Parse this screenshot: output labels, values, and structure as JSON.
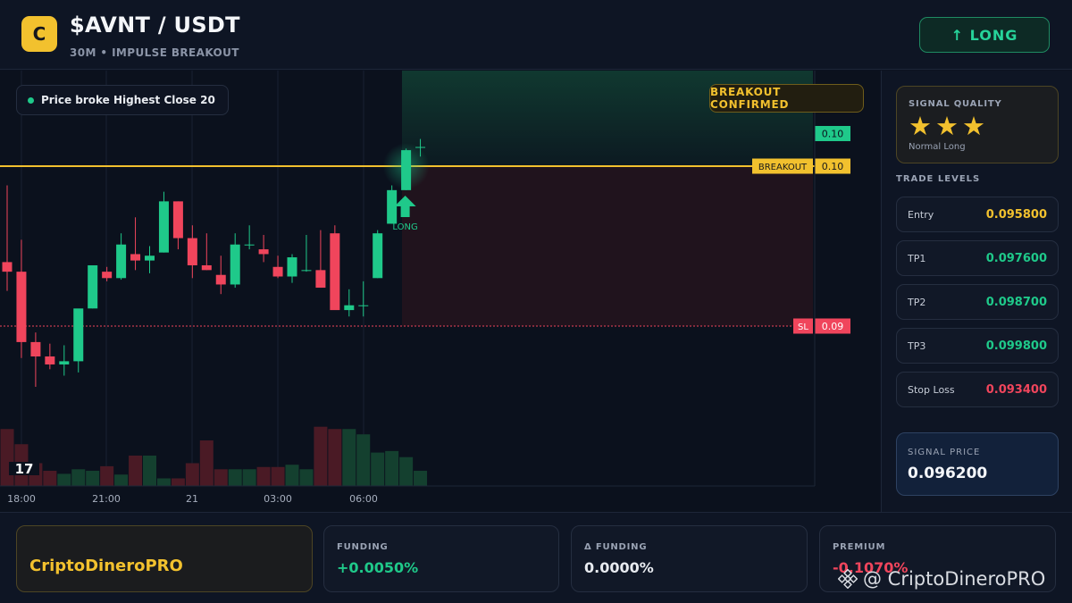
{
  "header": {
    "logo_letter": "C",
    "title": "$AVNT / USDT",
    "subtitle": "30M • IMPULSE BREAKOUT",
    "direction_button": "↑ LONG"
  },
  "chart": {
    "chip_text": "Price broke Highest Close 20",
    "confirm_badge": "BREAKOUT CONFIRMED",
    "price_tag_top": "0.10",
    "breakout_label": "BREAKOUT",
    "breakout_price": "0.10",
    "sl_label": "SL",
    "sl_price": "0.09",
    "long_marker_label": "LONG",
    "x_ticks": [
      "18:00",
      "21:00",
      "21",
      "03:00",
      "06:00"
    ],
    "tv_logo": "17",
    "colors": {
      "up": "#1fc98a",
      "down": "#f0455c",
      "breakout": "#f2c12e",
      "sl": "#f0455c"
    }
  },
  "chart_data": {
    "type": "candlestick",
    "x_ticks": [
      "18:00",
      "21:00",
      "21",
      "03:00",
      "06:00"
    ],
    "breakout_level": 0.1,
    "stop_loss_level": 0.09,
    "candles": [
      {
        "o": 0.094,
        "h": 0.0988,
        "l": 0.0922,
        "c": 0.0934
      },
      {
        "o": 0.0934,
        "h": 0.0954,
        "l": 0.088,
        "c": 0.089
      },
      {
        "o": 0.089,
        "h": 0.0896,
        "l": 0.0862,
        "c": 0.0881
      },
      {
        "o": 0.0881,
        "h": 0.0889,
        "l": 0.0873,
        "c": 0.0876
      },
      {
        "o": 0.0876,
        "h": 0.0888,
        "l": 0.0869,
        "c": 0.0878
      },
      {
        "o": 0.0878,
        "h": 0.0902,
        "l": 0.0871,
        "c": 0.0911
      },
      {
        "o": 0.0911,
        "h": 0.0935,
        "l": 0.0911,
        "c": 0.0938
      },
      {
        "o": 0.0934,
        "h": 0.0937,
        "l": 0.0928,
        "c": 0.093
      },
      {
        "o": 0.093,
        "h": 0.0958,
        "l": 0.0929,
        "c": 0.0951
      },
      {
        "o": 0.0945,
        "h": 0.0968,
        "l": 0.0935,
        "c": 0.0941
      },
      {
        "o": 0.0941,
        "h": 0.095,
        "l": 0.0933,
        "c": 0.0944
      },
      {
        "o": 0.0946,
        "h": 0.0984,
        "l": 0.0946,
        "c": 0.0978
      },
      {
        "o": 0.0978,
        "h": 0.0978,
        "l": 0.0948,
        "c": 0.0955
      },
      {
        "o": 0.0955,
        "h": 0.0963,
        "l": 0.093,
        "c": 0.0938
      },
      {
        "o": 0.0938,
        "h": 0.0958,
        "l": 0.0935,
        "c": 0.0935
      },
      {
        "o": 0.0932,
        "h": 0.0944,
        "l": 0.092,
        "c": 0.0926
      },
      {
        "o": 0.0926,
        "h": 0.0958,
        "l": 0.0924,
        "c": 0.0951
      },
      {
        "o": 0.0951,
        "h": 0.0963,
        "l": 0.0948,
        "c": 0.0951
      },
      {
        "o": 0.0948,
        "h": 0.0957,
        "l": 0.094,
        "c": 0.0945
      },
      {
        "o": 0.0937,
        "h": 0.0944,
        "l": 0.093,
        "c": 0.0931
      },
      {
        "o": 0.0931,
        "h": 0.0945,
        "l": 0.0927,
        "c": 0.0943
      },
      {
        "o": 0.0935,
        "h": 0.0957,
        "l": 0.0934,
        "c": 0.0935
      },
      {
        "o": 0.0935,
        "h": 0.096,
        "l": 0.0924,
        "c": 0.0924
      },
      {
        "o": 0.0958,
        "h": 0.0963,
        "l": 0.093,
        "c": 0.091
      },
      {
        "o": 0.091,
        "h": 0.0923,
        "l": 0.0906,
        "c": 0.0913
      },
      {
        "o": 0.0913,
        "h": 0.0928,
        "l": 0.0906,
        "c": 0.0913
      },
      {
        "o": 0.093,
        "h": 0.096,
        "l": 0.093,
        "c": 0.0958
      },
      {
        "o": 0.0964,
        "h": 0.0988,
        "l": 0.0964,
        "c": 0.0985
      },
      {
        "o": 0.0985,
        "h": 0.1011,
        "l": 0.0985,
        "c": 0.101
      },
      {
        "o": 0.1012,
        "h": 0.1017,
        "l": 0.1006,
        "c": 0.1012
      }
    ],
    "volumes": [
      0.75,
      0.55,
      0.3,
      0.2,
      0.16,
      0.22,
      0.2,
      0.26,
      0.15,
      0.4,
      0.4,
      0.1,
      0.1,
      0.3,
      0.6,
      0.22,
      0.22,
      0.22,
      0.25,
      0.25,
      0.28,
      0.22,
      0.78,
      0.75,
      0.75,
      0.68,
      0.44,
      0.46,
      0.38,
      0.2
    ]
  },
  "sidebar": {
    "quality_label": "SIGNAL QUALITY",
    "stars": "★★★",
    "quality_sub": "Normal Long",
    "levels_title": "TRADE LEVELS",
    "levels": [
      {
        "name": "Entry",
        "value": "0.095800"
      },
      {
        "name": "TP1",
        "value": "0.097600"
      },
      {
        "name": "TP2",
        "value": "0.098700"
      },
      {
        "name": "TP3",
        "value": "0.099800"
      },
      {
        "name": "Stop Loss",
        "value": "0.093400"
      }
    ],
    "level_colors": [
      "#f2c12e",
      "#1fc98a",
      "#1fc98a",
      "#1fc98a",
      "#f0455c"
    ],
    "signal_price_label": "SIGNAL PRICE",
    "signal_price": "0.096200"
  },
  "footer": {
    "brand": "CriptoDineroPRO",
    "funding_label": "FUNDING",
    "funding_value": "+0.0050%",
    "delta_label": "Δ FUNDING",
    "delta_value": "0.0000%",
    "premium_label": "PREMIUM",
    "premium_value": "-0.1070%",
    "watermark": "@ CriptoDineroPRO"
  }
}
